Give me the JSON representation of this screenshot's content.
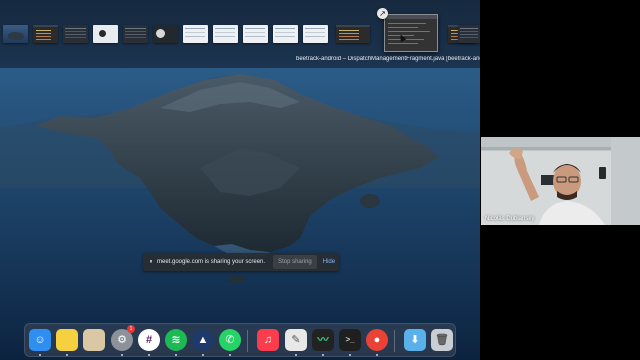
{
  "mission_control": {
    "window_title": "beetrack-android – DispatchManagementFragment.java [beetrack-andr",
    "thumbnails": [
      {
        "kind": "wp"
      },
      {
        "kind": "ide"
      },
      {
        "kind": "dark"
      },
      {
        "kind": "gh"
      },
      {
        "kind": "dark"
      },
      {
        "kind": "profile"
      },
      {
        "kind": "light"
      },
      {
        "kind": "light"
      },
      {
        "kind": "light"
      },
      {
        "kind": "light"
      },
      {
        "kind": "light"
      },
      {
        "kind": "ide"
      },
      {
        "kind": "ide"
      },
      {
        "kind": "dark"
      }
    ],
    "close_glyph": "↗"
  },
  "share_bar": {
    "pause_glyph": "⏸",
    "message": "meet.google.com is sharing your screen.",
    "stop_label": "Stop sharing",
    "hide_label": "Hide"
  },
  "dock": {
    "apps": [
      {
        "name": "finder-icon",
        "color": "#2f8ff0",
        "glyph": "☺",
        "running": true
      },
      {
        "name": "notes-icon",
        "color": "#f5d142",
        "glyph": "",
        "running": true
      },
      {
        "name": "preview-icon",
        "color": "#d9c8a3",
        "glyph": "",
        "running": false
      },
      {
        "name": "system-preferences-icon",
        "color": "#8d929a",
        "glyph": "⚙",
        "running": true,
        "badge": "1"
      },
      {
        "name": "slack-icon",
        "color": "#ffffff",
        "glyph": "#",
        "running": true
      },
      {
        "name": "spotify-icon",
        "color": "#1db954",
        "glyph": "≋",
        "running": true
      },
      {
        "name": "vpn-icon",
        "color": "#1d3a6b",
        "glyph": "▲",
        "running": true
      },
      {
        "name": "whatsapp-icon",
        "color": "#25d366",
        "glyph": "✆",
        "running": true
      },
      {
        "name": "music-icon",
        "color": "#fa3c4c",
        "glyph": "♫",
        "running": false
      },
      {
        "name": "script-editor-icon",
        "color": "#e8e8e8",
        "glyph": "✎",
        "running": true
      },
      {
        "name": "activity-monitor-icon",
        "color": "#222222",
        "glyph": "〰",
        "running": true
      },
      {
        "name": "terminal-icon",
        "color": "#1f1f1f",
        "glyph": ">_",
        "running": true
      },
      {
        "name": "chrome-icon",
        "color": "#ea4335",
        "glyph": "●",
        "running": true
      },
      {
        "name": "downloads-folder-icon",
        "color": "#5ab0ea",
        "glyph": "⬇",
        "running": false
      },
      {
        "name": "trash-icon",
        "color": "#c9ced4",
        "glyph": "🗑",
        "running": false
      }
    ]
  },
  "participant": {
    "name": "Nicolás Dubiansky"
  }
}
